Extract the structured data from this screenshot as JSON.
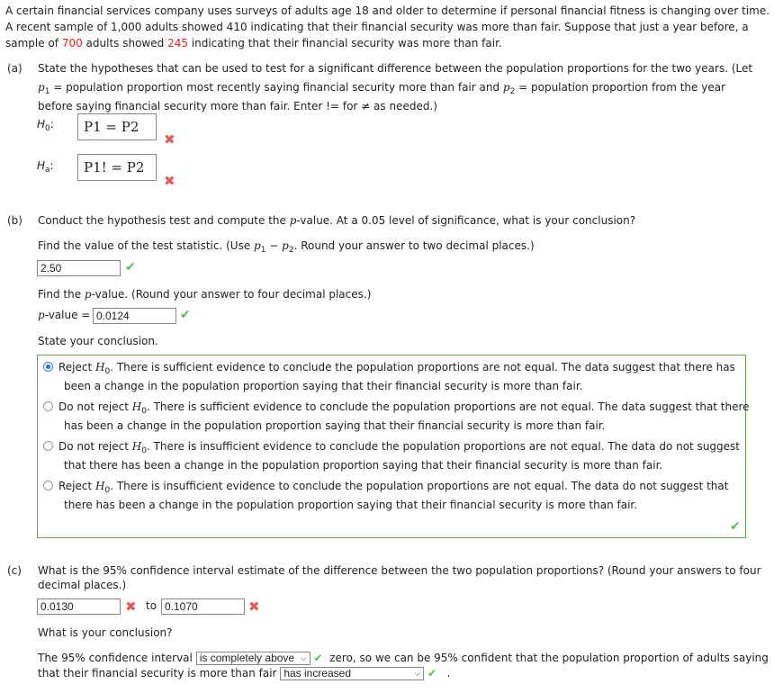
{
  "intro": {
    "pre1": "A certain financial services company uses surveys of adults age 18 and older to determine if personal financial fitness is changing over time. A recent sample of 1,000 adults showed 410 indicating that their financial security was more than fair. Suppose that just a year before, a sample of ",
    "n_prev": "700",
    "mid": " adults showed ",
    "x_prev": "245",
    "post": " indicating that their financial security was more than fair."
  },
  "part_a": {
    "label": "(a)",
    "text1": "State the hypotheses that can be used to test for a significant difference between the population proportions for the two years. (Let ",
    "p1": "p",
    "s1": "1",
    "text2": " = population proportion most recently saying financial security more than fair and ",
    "p2": "p",
    "s2": "2",
    "text3": " = population proportion from the year before saying financial security more than fair. Enter != for ≠ as needed.)",
    "h0_label": "H",
    "h0_sub": "0",
    "h0_value": "P1 = P2",
    "ha_label": "H",
    "ha_sub": "a",
    "ha_value": "P1! = P2",
    "colon": ":",
    "wrong_icon": "✖"
  },
  "part_b": {
    "label": "(b)",
    "intro_a": "Conduct the hypothesis test and compute the ",
    "pv": "p",
    "intro_b": "-value. At a 0.05 level of significance, what is your conclusion?",
    "stat_prompt_a": "Find the value of the test statistic. (Use ",
    "stat_prompt_b": " − ",
    "stat_prompt_c": ". Round your answer to two decimal places.)",
    "test_statistic": "2.50",
    "pvalue_prompt_a": "Find the ",
    "pvalue_prompt_b": "-value. (Round your answer to four decimal places.)",
    "pvalue_label_b": "-value =",
    "pvalue": "0.0124",
    "conclusion_prompt": "State your conclusion.",
    "correct_icon": "✔",
    "choices": [
      {
        "lead": "Reject ",
        "rest1": ". There is sufficient evidence to conclude the population proportions are not equal. The data suggest that there has",
        "rest2": "been a change in the population proportion saying that their financial security is more than fair.",
        "selected": true
      },
      {
        "lead": "Do not reject ",
        "rest1": ". There is sufficient evidence to conclude the population proportions are not equal. The data suggest that there",
        "rest2": "has been a change in the population proportion saying that their financial security is more than fair.",
        "selected": false
      },
      {
        "lead": "Do not reject ",
        "rest1": ". There is insufficient evidence to conclude the population proportions are not equal. The data do not suggest",
        "rest2": "that there has been a change in the population proportion saying that their financial security is more than fair.",
        "selected": false
      },
      {
        "lead": "Reject ",
        "rest1": ". There is insufficient evidence to conclude the population proportions are not equal. The data do not suggest that",
        "rest2": "there has been a change in the population proportion saying that their financial security is more than fair.",
        "selected": false
      }
    ]
  },
  "part_c": {
    "label": "(c)",
    "text1": "What is the 95% confidence interval estimate of the difference between the two population proportions? (Round your answers to four",
    "text2": "decimal places.)",
    "ci_lower": "0.0130",
    "to_label": "to",
    "ci_upper": "0.1070",
    "conclusion_prompt": "What is your conclusion?",
    "sent_a": "The 95% confidence interval",
    "select1_value": "is completely above",
    "sent_b": "zero, so we can be 95% confident that the population proportion of adults saying",
    "sent_c": "that their financial security is more than fair",
    "select2_value": "has increased",
    "period": "."
  },
  "colors": {
    "wrong": "#e85a5a",
    "correct": "#5cb85c",
    "highlight": "#e32222",
    "box_border": "#6aa84f",
    "radio": "#1e6fe0"
  }
}
